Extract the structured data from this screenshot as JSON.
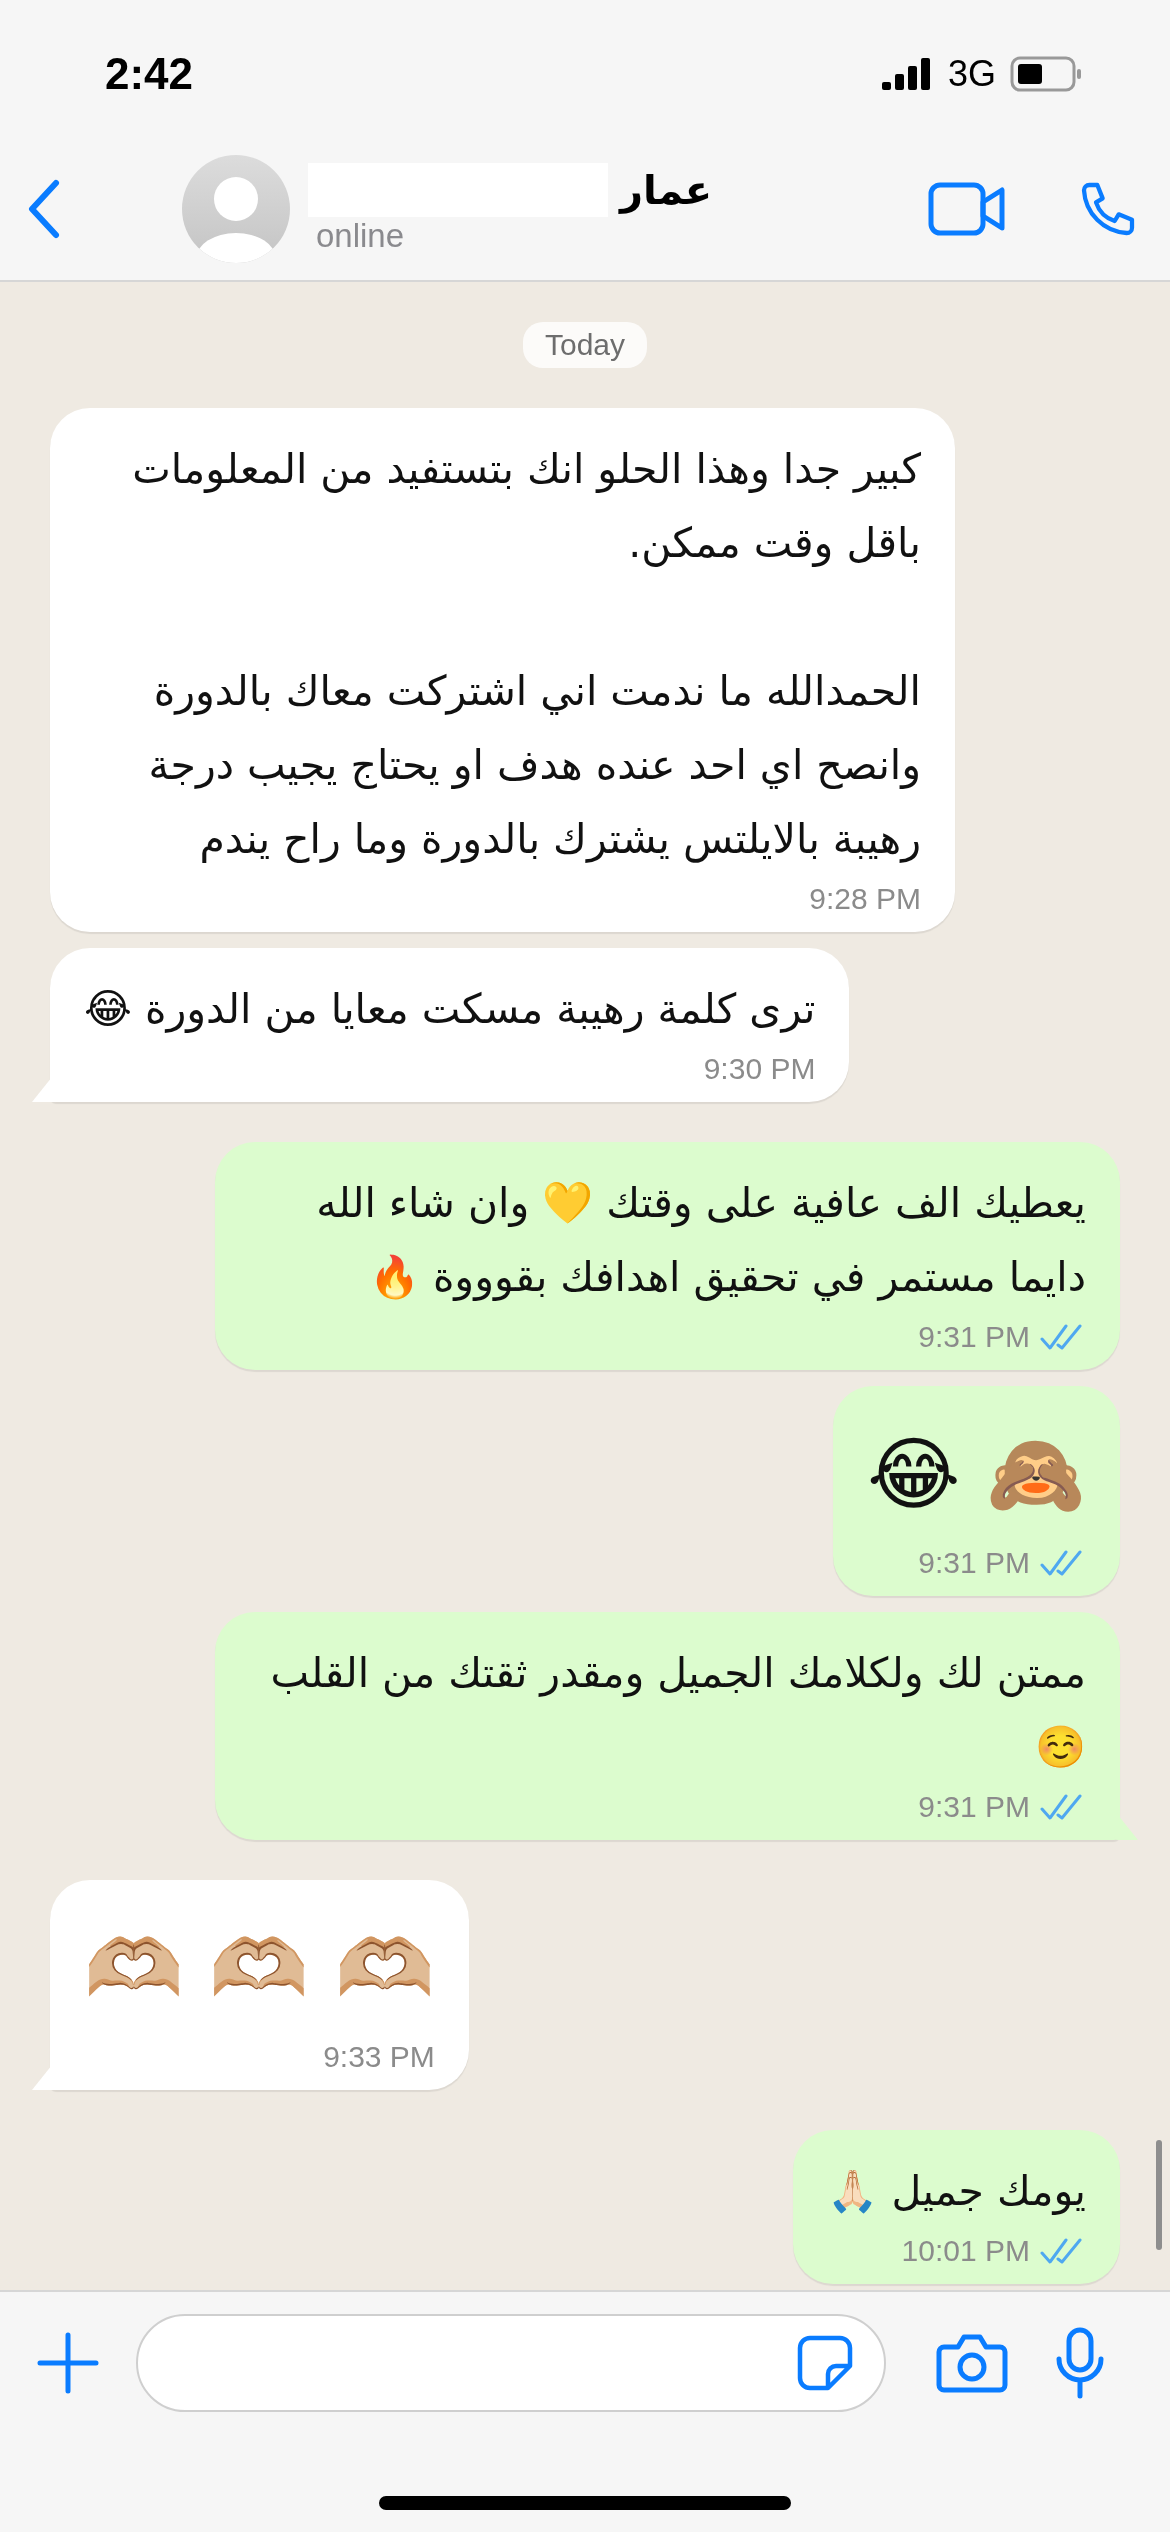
{
  "status_bar": {
    "time": "2:42",
    "network": "3G"
  },
  "header": {
    "contact": {
      "name": "عمار",
      "status": "online"
    }
  },
  "date_badge": "Today",
  "messages": [
    {
      "outgoing": false,
      "kind": "text",
      "tail": false,
      "paragraphs": [
        "كبير جدا وهذا الحلو انك بتستفيد من المعلومات باقل وقت ممكن.",
        "الحمدالله ما ندمت اني اشتركت معاك بالدورة وانصح اي احد عنده هدف او يحتاج يجيب درجة رهيبة بالايلتس يشترك بالدورة وما راح يندم"
      ],
      "time": "9:28 PM"
    },
    {
      "outgoing": false,
      "kind": "text",
      "tail": true,
      "paragraphs": [
        "ترى كلمة رهيبة مسكت معايا من الدورة 😂"
      ],
      "time": "9:30 PM"
    },
    {
      "outgoing": true,
      "kind": "text",
      "tail": false,
      "paragraphs": [
        "يعطيك الف عافية على وقتك 💛 وان شاء الله دايما مستمر في تحقيق اهدافك بقوووة 🔥"
      ],
      "time": "9:31 PM",
      "read": true
    },
    {
      "outgoing": true,
      "kind": "emoji",
      "tail": false,
      "paragraphs": [
        "🙈 😂"
      ],
      "time": "9:31 PM",
      "read": true
    },
    {
      "outgoing": true,
      "kind": "text",
      "tail": true,
      "paragraphs": [
        "ممتن لك ولكلامك الجميل ومقدر ثقتك من القلب ☺️"
      ],
      "time": "9:31 PM",
      "read": true
    },
    {
      "outgoing": false,
      "kind": "emoji",
      "tail": true,
      "paragraphs": [
        "🫶🏼 🫶🏼 🫶🏼"
      ],
      "time": "9:33 PM"
    },
    {
      "outgoing": true,
      "kind": "text",
      "tail": false,
      "paragraphs": [
        "يومك جميل 🙏🏻"
      ],
      "time": "10:01 PM",
      "read": true
    }
  ]
}
